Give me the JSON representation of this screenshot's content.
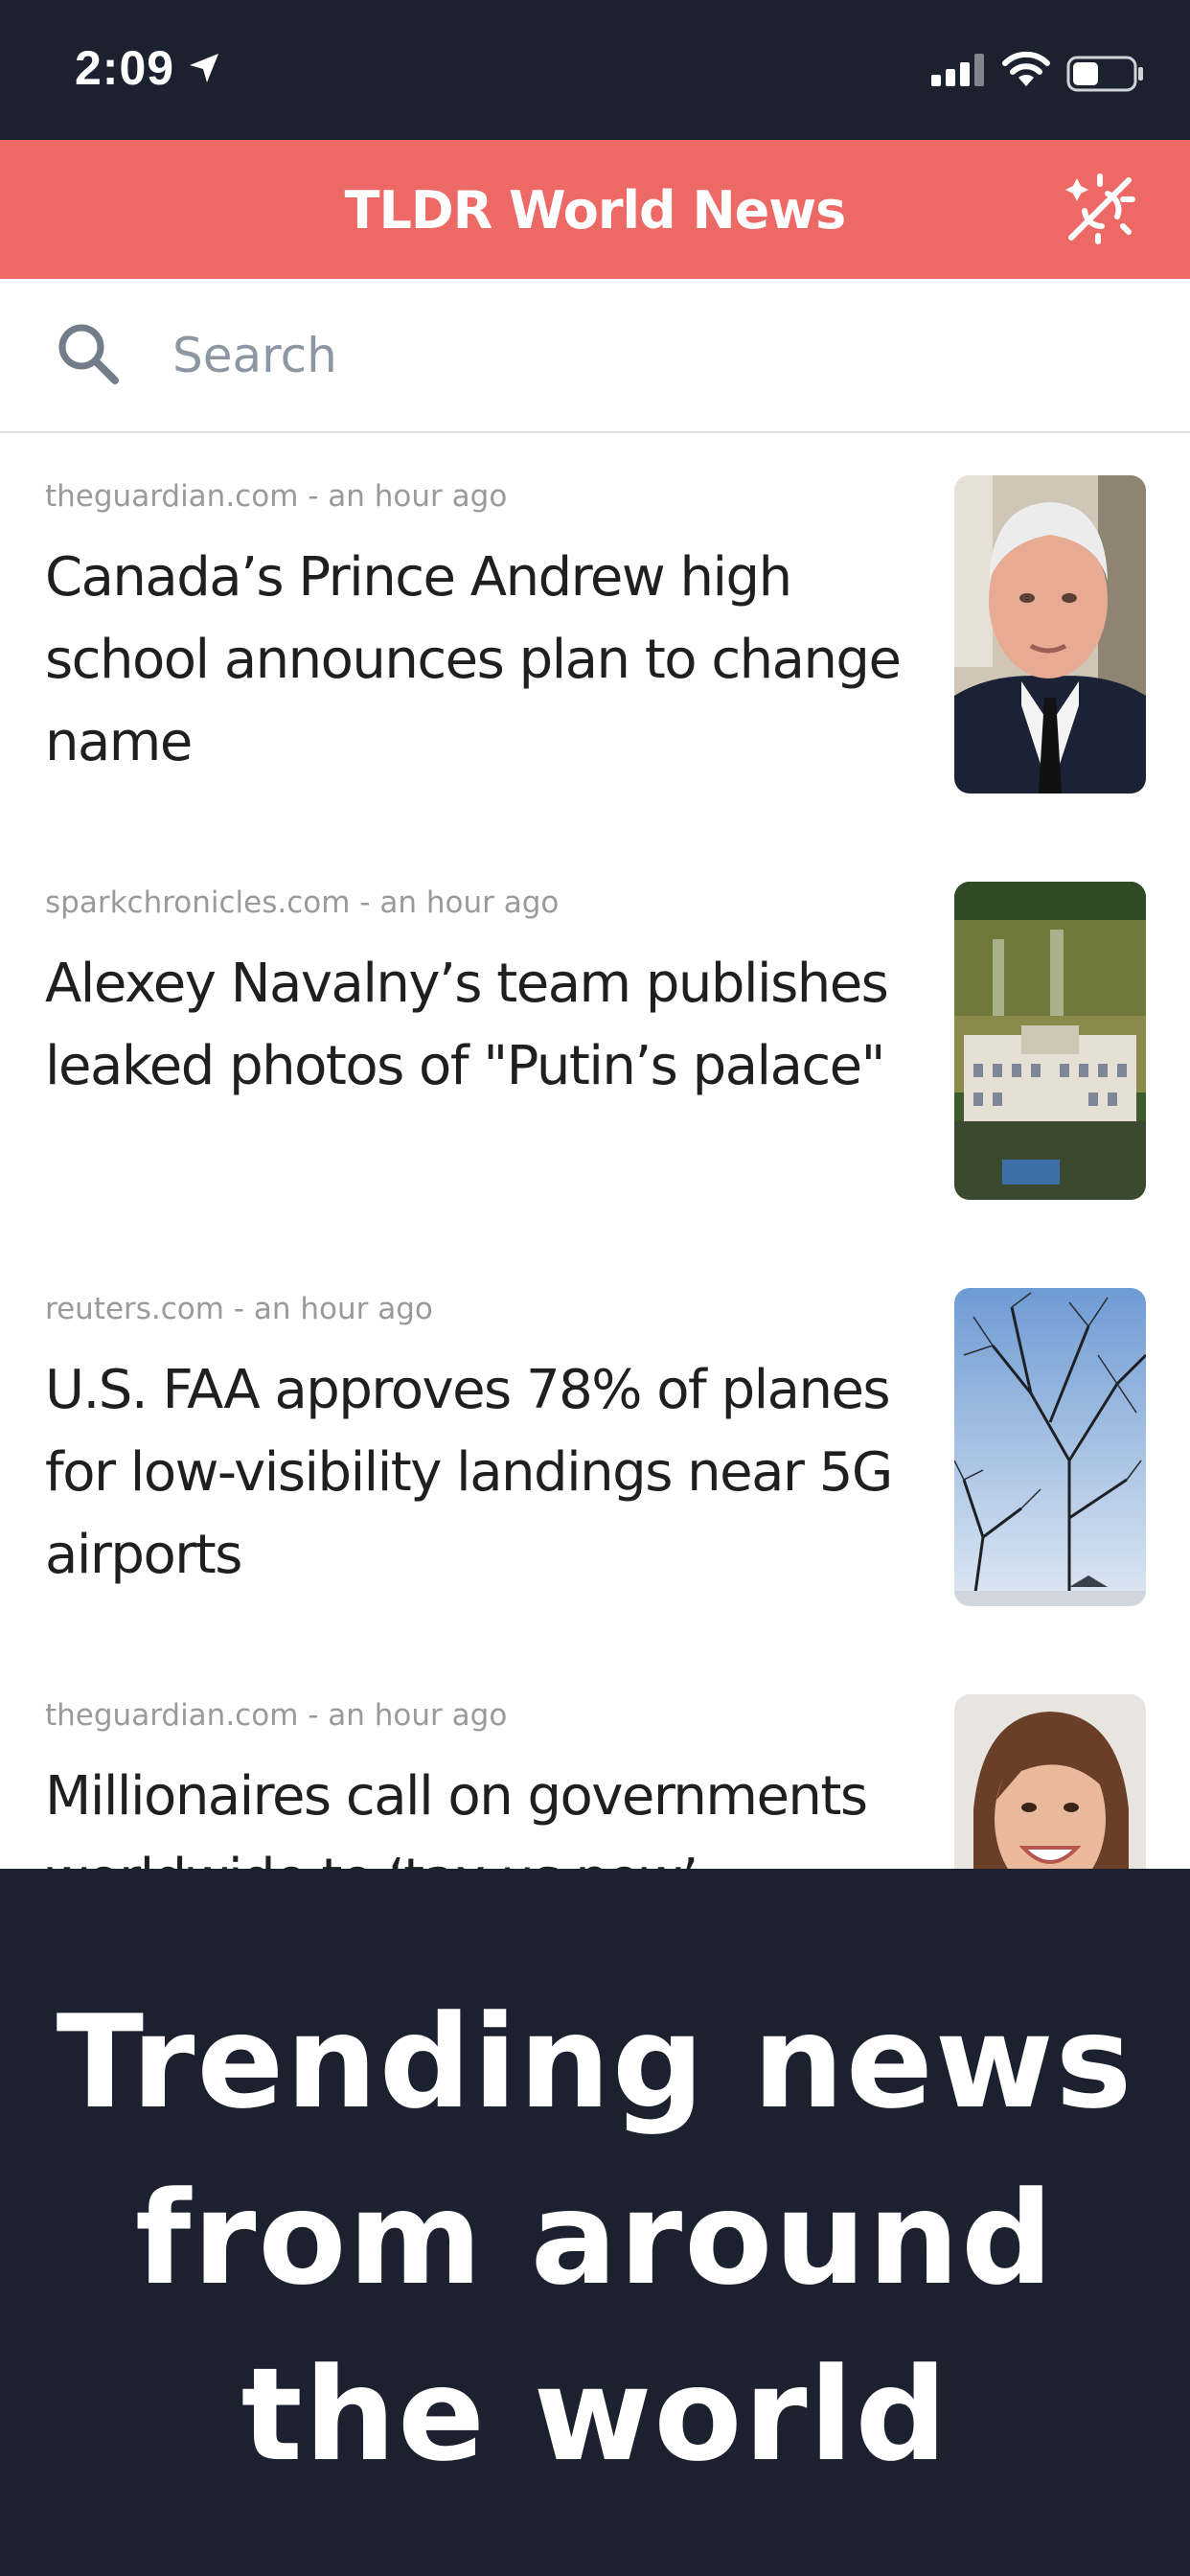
{
  "status_bar": {
    "time": "2:09"
  },
  "header": {
    "title": "TLDR World News"
  },
  "search": {
    "placeholder": "Search",
    "value": ""
  },
  "articles": [
    {
      "source": "theguardian.com",
      "age": "an hour ago",
      "meta": "theguardian.com - an hour ago",
      "title": "Canada’s Prince Andrew high school announces plan to change name",
      "thumbnail": "man-in-suit-photo"
    },
    {
      "source": "sparkchronicles.com",
      "age": "an hour ago",
      "meta": "sparkchronicles.com - an hour ago",
      "title": "Alexey Navalny’s team publishes leaked photos of \"Putin’s palace\"",
      "thumbnail": "palace-aerial-photo"
    },
    {
      "source": "reuters.com",
      "age": "an hour ago",
      "meta": "reuters.com - an hour ago",
      "title": "U.S. FAA approves 78% of planes for low-visibility landings near 5G airports",
      "thumbnail": "bare-trees-sky-photo"
    },
    {
      "source": "theguardian.com",
      "age": "an hour ago",
      "meta": "theguardian.com - an hour ago",
      "title": "Millionaires call on governments worldwide to ‘tax us now’",
      "thumbnail": "smiling-woman-photo"
    }
  ],
  "promo": {
    "tagline": "Trending news from around the world"
  },
  "colors": {
    "header": "#ec6966",
    "dark": "#1c2130",
    "meta_text": "#9a9a9a",
    "headline_text": "#1f1f1f"
  }
}
